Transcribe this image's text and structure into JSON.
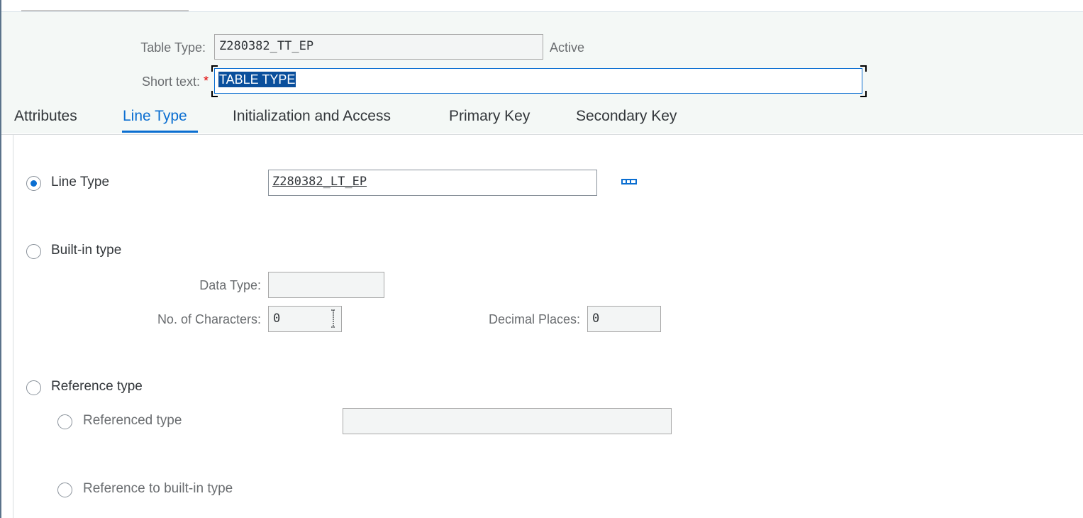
{
  "header": {
    "table_type_label": "Table Type:",
    "table_type_value": "Z280382_TT_EP",
    "status": "Active",
    "short_text_label": "Short text:",
    "required_marker": "*",
    "short_text_value": "TABLE TYPE"
  },
  "tabs": [
    {
      "label": "Attributes",
      "active": false
    },
    {
      "label": "Line Type",
      "active": true
    },
    {
      "label": "Initialization and Access",
      "active": false
    },
    {
      "label": "Primary Key",
      "active": false
    },
    {
      "label": "Secondary Key",
      "active": false
    }
  ],
  "line_type": {
    "radio_label": "Line Type",
    "selected": true,
    "value": "Z280382_LT_EP",
    "value_help_icon": "value-help-icon"
  },
  "builtin": {
    "radio_label": "Built-in type",
    "selected": false,
    "data_type_label": "Data Type:",
    "data_type_value": "",
    "chars_label": "No. of Characters:",
    "chars_value": "0",
    "decimals_label": "Decimal Places:",
    "decimals_value": "0"
  },
  "reference": {
    "radio_label": "Reference type",
    "selected": false,
    "referenced_type_label": "Referenced type",
    "referenced_type_value": "",
    "ref_builtin_label": "Reference to built-in type"
  },
  "colors": {
    "accent": "#0a6ed1",
    "header_bg": "#f4f8f6",
    "required": "#e00000"
  }
}
